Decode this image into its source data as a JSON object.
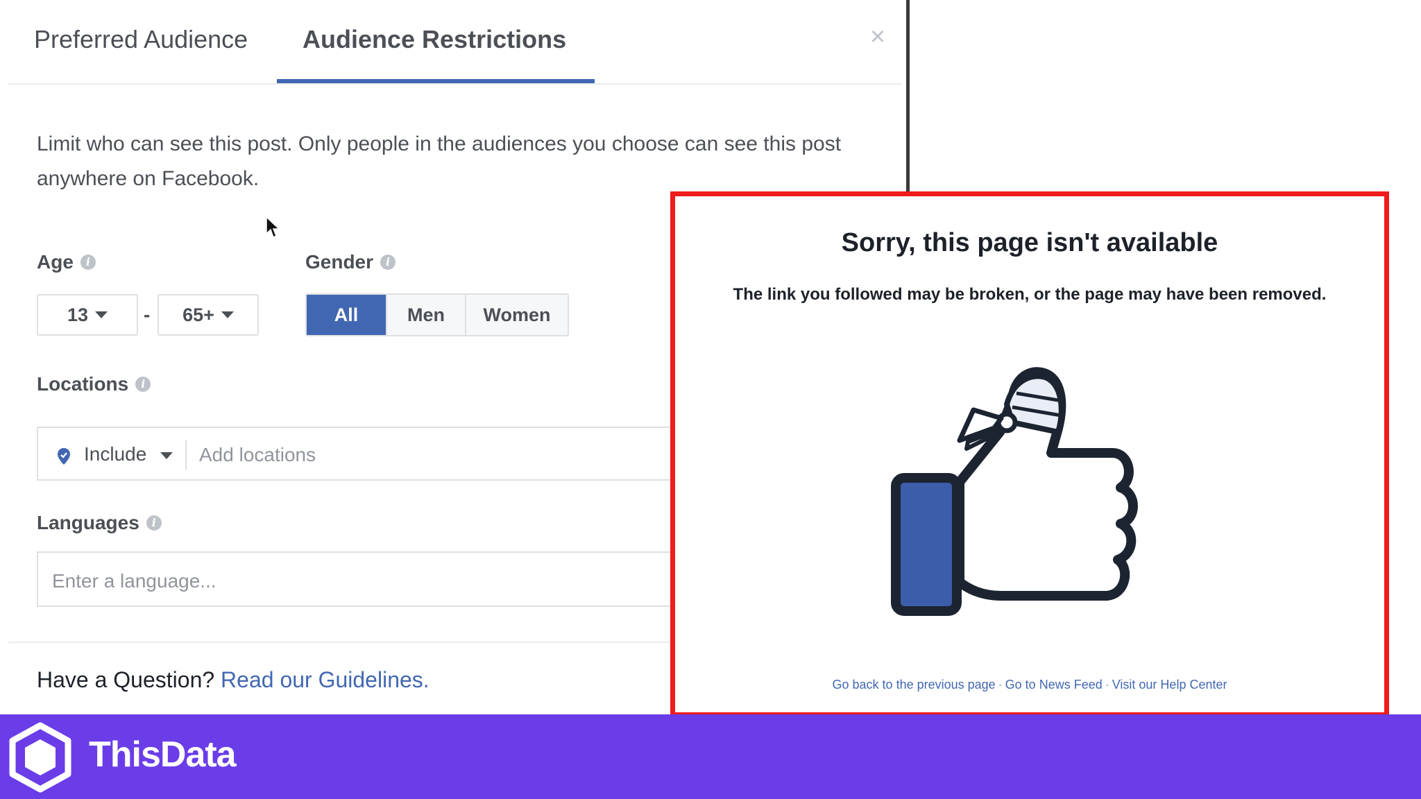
{
  "dialog": {
    "tabs": [
      {
        "label": "Preferred Audience",
        "active": false
      },
      {
        "label": "Audience Restrictions",
        "active": true
      }
    ],
    "close_symbol": "×",
    "description": "Limit who can see this post. Only people in the audiences you choose can see this post anywhere on Facebook.",
    "age": {
      "label": "Age",
      "min": "13",
      "separator": "-",
      "max": "65+"
    },
    "gender": {
      "label": "Gender",
      "options": [
        "All",
        "Men",
        "Women"
      ],
      "selected": "All"
    },
    "locations": {
      "label": "Locations",
      "mode": "Include",
      "placeholder": "Add locations"
    },
    "languages": {
      "label": "Languages",
      "placeholder": "Enter a language..."
    },
    "footer": {
      "question": "Have a Question?",
      "link": "Read our Guidelines."
    },
    "accent_color": "#4267b2"
  },
  "error_page": {
    "title": "Sorry, this page isn't available",
    "subtitle": "The link you followed may be broken, or the page may have been removed.",
    "links": [
      "Go back to the previous page",
      "Go to News Feed",
      "Visit our Help Center"
    ],
    "link_separator": "·",
    "illustration": "bandaged-thumbs-up-icon",
    "highlight_color": "#ee1c1c"
  },
  "brand": {
    "name": "ThisData",
    "color": "#6a3de8"
  }
}
